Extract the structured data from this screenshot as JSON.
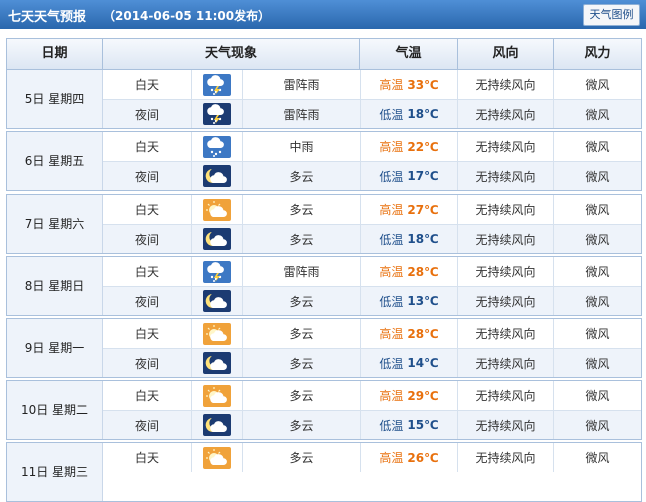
{
  "header": {
    "title": "七天天气预报",
    "date": "（2014-06-05 11:00发布）",
    "map_button": "天气图例"
  },
  "columns": {
    "date": "日期",
    "weather": "天气现象",
    "temp": "气温",
    "wind_dir": "风向",
    "wind_force": "风力"
  },
  "labels": {
    "day": "白天",
    "night": "夜间",
    "high": "高温",
    "low": "低温"
  },
  "days": [
    {
      "date": "5日 星期四",
      "day": {
        "icon": "thunderstorm-icon",
        "desc": "雷阵雨",
        "temp": "33℃",
        "wind_dir": "无持续风向",
        "wind_force": "微风"
      },
      "night": {
        "icon": "thunderstorm-night-icon",
        "desc": "雷阵雨",
        "temp": "18℃",
        "wind_dir": "无持续风向",
        "wind_force": "微风"
      }
    },
    {
      "date": "6日 星期五",
      "day": {
        "icon": "rain-icon",
        "desc": "中雨",
        "temp": "22℃",
        "wind_dir": "无持续风向",
        "wind_force": "微风"
      },
      "night": {
        "icon": "cloudy-night-icon",
        "desc": "多云",
        "temp": "17℃",
        "wind_dir": "无持续风向",
        "wind_force": "微风"
      }
    },
    {
      "date": "7日 星期六",
      "day": {
        "icon": "partly-cloudy-icon",
        "desc": "多云",
        "temp": "27℃",
        "wind_dir": "无持续风向",
        "wind_force": "微风"
      },
      "night": {
        "icon": "cloudy-night-icon",
        "desc": "多云",
        "temp": "18℃",
        "wind_dir": "无持续风向",
        "wind_force": "微风"
      }
    },
    {
      "date": "8日 星期日",
      "day": {
        "icon": "thunderstorm-icon",
        "desc": "雷阵雨",
        "temp": "28℃",
        "wind_dir": "无持续风向",
        "wind_force": "微风"
      },
      "night": {
        "icon": "cloudy-night-icon",
        "desc": "多云",
        "temp": "13℃",
        "wind_dir": "无持续风向",
        "wind_force": "微风"
      }
    },
    {
      "date": "9日 星期一",
      "day": {
        "icon": "partly-cloudy-icon",
        "desc": "多云",
        "temp": "28℃",
        "wind_dir": "无持续风向",
        "wind_force": "微风"
      },
      "night": {
        "icon": "cloudy-night-icon",
        "desc": "多云",
        "temp": "14℃",
        "wind_dir": "无持续风向",
        "wind_force": "微风"
      }
    },
    {
      "date": "10日 星期二",
      "day": {
        "icon": "partly-cloudy-icon",
        "desc": "多云",
        "temp": "29℃",
        "wind_dir": "无持续风向",
        "wind_force": "微风"
      },
      "night": {
        "icon": "cloudy-night-icon",
        "desc": "多云",
        "temp": "15℃",
        "wind_dir": "无持续风向",
        "wind_force": "微风"
      }
    },
    {
      "date": "11日 星期三",
      "day": {
        "icon": "partly-cloudy-icon",
        "desc": "多云",
        "temp": "26℃",
        "wind_dir": "无持续风向",
        "wind_force": "微风"
      },
      "night": null
    }
  ],
  "colors": {
    "title_bar": "#3575bc",
    "high_temp": "#e8700d",
    "low_temp": "#1f4f8b",
    "row_alt": "#eef3fa"
  }
}
